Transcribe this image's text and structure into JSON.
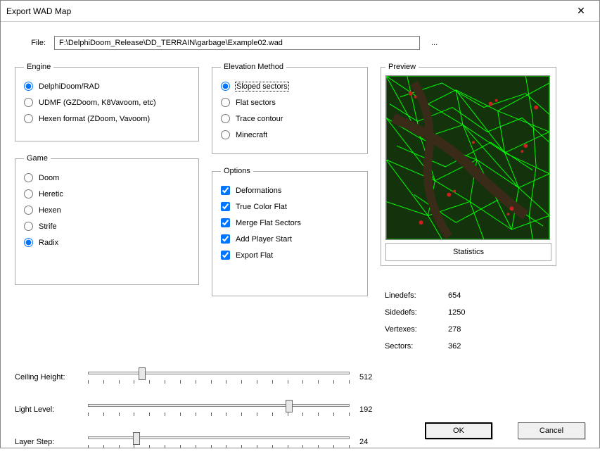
{
  "window": {
    "title": "Export WAD Map"
  },
  "file": {
    "label": "File:",
    "value": "F:\\DelphiDoom_Release\\DD_TERRAIN\\garbage\\Example02.wad",
    "browse": "..."
  },
  "engine": {
    "legend": "Engine",
    "options": [
      {
        "label": "DelphiDoom/RAD",
        "checked": true
      },
      {
        "label": "UDMF (GZDoom, K8Vavoom, etc)",
        "checked": false
      },
      {
        "label": "Hexen format (ZDoom, Vavoom)",
        "checked": false
      }
    ]
  },
  "game": {
    "legend": "Game",
    "options": [
      {
        "label": "Doom",
        "checked": false
      },
      {
        "label": "Heretic",
        "checked": false
      },
      {
        "label": "Hexen",
        "checked": false
      },
      {
        "label": "Strife",
        "checked": false
      },
      {
        "label": "Radix",
        "checked": true
      }
    ]
  },
  "elevation": {
    "legend": "Elevation Method",
    "options": [
      {
        "label": "Sloped sectors",
        "checked": true,
        "highlight": true
      },
      {
        "label": "Flat sectors",
        "checked": false
      },
      {
        "label": "Trace contour",
        "checked": false
      },
      {
        "label": "Minecraft",
        "checked": false
      }
    ]
  },
  "options": {
    "legend": "Options",
    "items": [
      {
        "label": "Deformations",
        "checked": true
      },
      {
        "label": "True Color Flat",
        "checked": true
      },
      {
        "label": "Merge Flat Sectors",
        "checked": true
      },
      {
        "label": "Add Player Start",
        "checked": true
      },
      {
        "label": "Export Flat",
        "checked": true
      }
    ]
  },
  "preview": {
    "legend": "Preview",
    "stats_label": "Statistics"
  },
  "stats": [
    {
      "key": "Linedefs:",
      "val": "654"
    },
    {
      "key": "Sidedefs:",
      "val": "1250"
    },
    {
      "key": "Vertexes:",
      "val": "278"
    },
    {
      "key": "Sectors:",
      "val": "362"
    }
  ],
  "sliders": {
    "ceiling": {
      "label": "Ceiling Height:",
      "value": "512",
      "pos_pct": 20
    },
    "light": {
      "label": "Light Level:",
      "value": "192",
      "pos_pct": 75
    },
    "layer": {
      "label": "Layer Step:",
      "value": "24",
      "pos_pct": 18
    }
  },
  "buttons": {
    "ok": "OK",
    "cancel": "Cancel"
  }
}
